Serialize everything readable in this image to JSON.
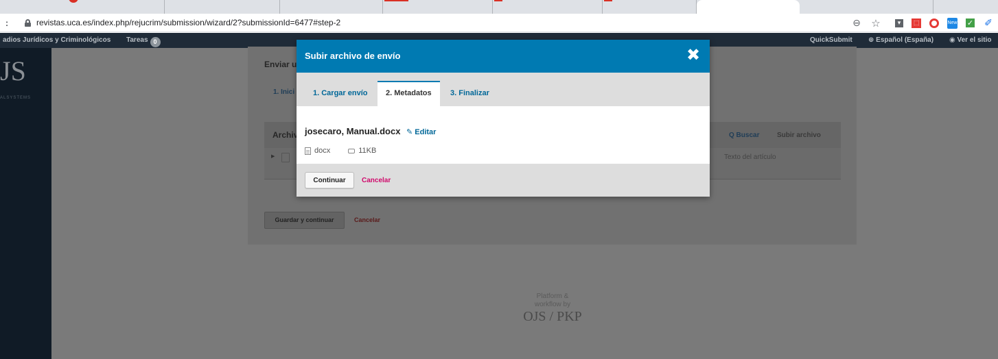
{
  "browser": {
    "url_host": "revistas.uca.es",
    "url_path": "/index.php/rejucrim/submission/wizard/2?submissionId=6477#step-2",
    "back_glyph": ":",
    "zoom_glyph": "⊖",
    "star_glyph": "☆",
    "ext_new_label": "New",
    "ext_check_glyph": "✓",
    "ext_feather_glyph": "✐"
  },
  "topbar": {
    "journal_name": "adios Jurídicos y Criminológicos",
    "tasks_label": "Tareas",
    "tasks_count": "0",
    "quicksubmit": "QuickSubmit",
    "language": "⊕ Español (España)",
    "view_site": "◉ Ver el sitio"
  },
  "sidebar": {
    "logo": "JS",
    "logo_sub": "ALSYSTEMS"
  },
  "background_panel": {
    "title": "Enviar u",
    "step_label": "1. Inici",
    "files_header": "Archiv",
    "search_label": "Q Buscar",
    "upload_label": "Subir archivo",
    "file_component": "Texto del artículo",
    "save_continue": "Guardar y continuar",
    "cancel": "Cancelar"
  },
  "footer": {
    "line1": "Platform &",
    "line2": "workflow by",
    "brand": "OJS / PKP"
  },
  "modal": {
    "title": "Subir archivo de envío",
    "close_glyph": "✖",
    "tabs": [
      {
        "label": "1. Cargar envío"
      },
      {
        "label": "2. Metadatos"
      },
      {
        "label": "3. Finalizar"
      }
    ],
    "file_name": "josecaro, Manual.docx",
    "edit_label": "✎ Editar",
    "file_type": "docx",
    "file_size": "11KB",
    "continue_label": "Continuar",
    "cancel_label": "Cancelar"
  },
  "colors": {
    "modal_header": "#007ab2",
    "link": "#006798",
    "cancel": "#d00a6c",
    "overlay": "#7a7a7a"
  }
}
